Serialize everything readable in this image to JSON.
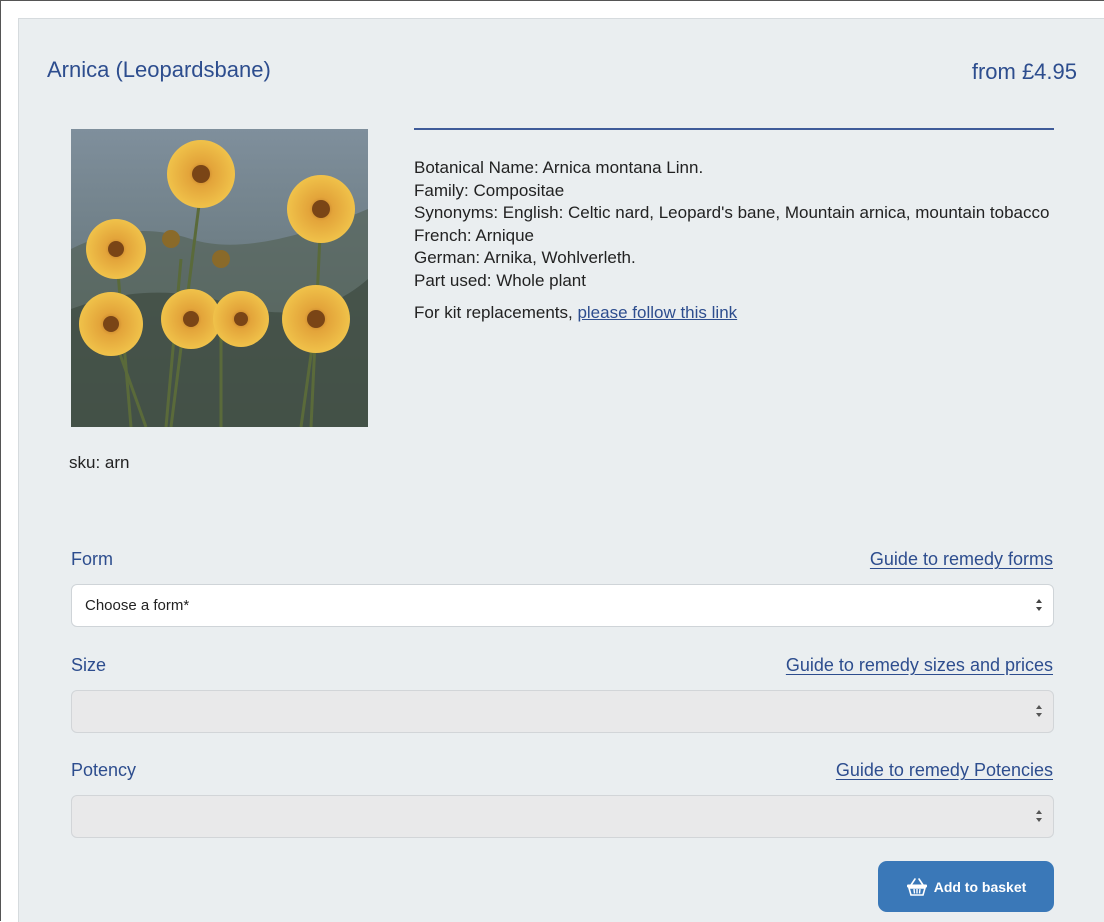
{
  "product": {
    "title": "Arnica (Leopardsbane)",
    "price": "from £4.95",
    "image": {
      "alt": "Photo of Arnica montana flowers",
      "icon": "product-photo"
    },
    "sku": "sku: arn"
  },
  "details": {
    "lines": [
      "Botanical Name: Arnica montana Linn.",
      "Family: Compositae",
      "Synonyms: English: Celtic nard, Leopard's bane, Mountain arnica, mountain tobacco",
      "French: Arnique",
      "German: Arnika, Wohlverleth.",
      "Part used: Whole plant"
    ],
    "kit_prefix": "For kit replacements, ",
    "kit_link": "please follow this link"
  },
  "options": [
    {
      "label": "Form",
      "guide": "Guide to remedy forms",
      "value": "Choose a form*",
      "enabled": true
    },
    {
      "label": "Size",
      "guide": "Guide to remedy sizes and prices",
      "value": "",
      "enabled": false
    },
    {
      "label": "Potency",
      "guide": "Guide to remedy Potencies",
      "value": "",
      "enabled": false
    }
  ],
  "basket": {
    "label": "Add to basket",
    "icon": "basket-icon",
    "color": "#3a78b8"
  },
  "colors": {
    "accent": "#2d4d8e",
    "panel": "#eaeef0"
  }
}
